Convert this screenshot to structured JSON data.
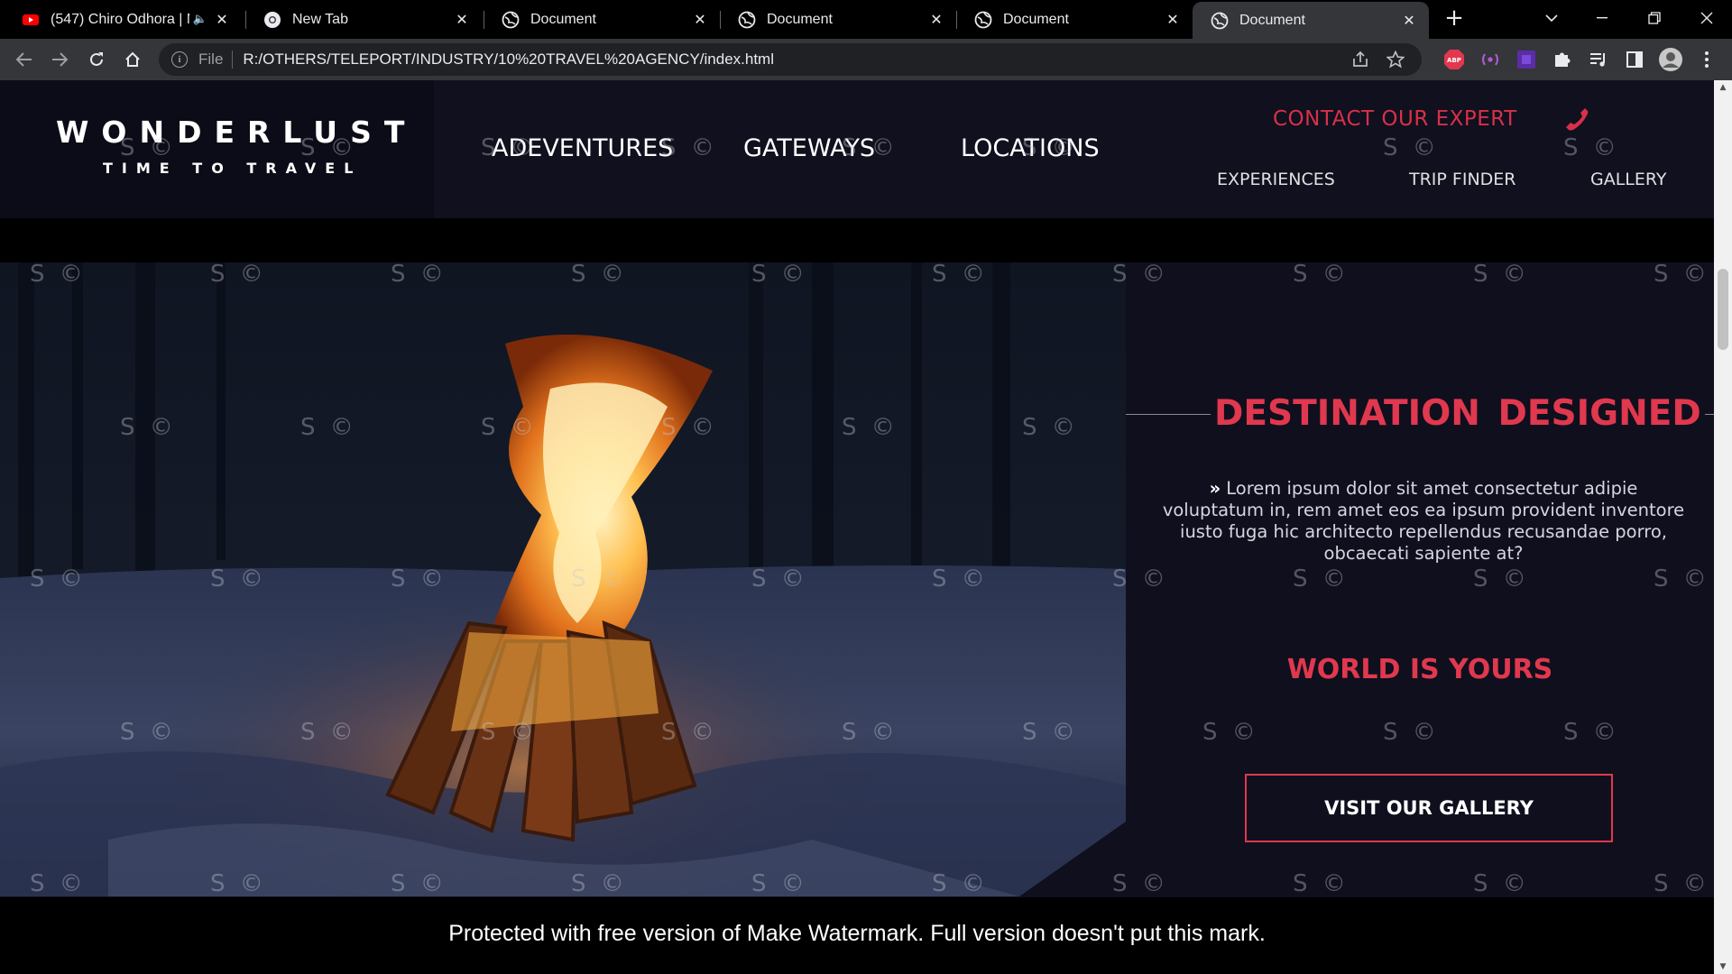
{
  "browser": {
    "tabs": [
      {
        "title": "(547) Chiro Odhora | M",
        "favicon": "youtube-icon",
        "muted": true,
        "active": false
      },
      {
        "title": "New Tab",
        "favicon": "chrome-icon",
        "active": false
      },
      {
        "title": "Document",
        "favicon": "globe-icon",
        "active": false
      },
      {
        "title": "Document",
        "favicon": "globe-icon",
        "active": false
      },
      {
        "title": "Document",
        "favicon": "globe-icon",
        "active": false
      },
      {
        "title": "Document",
        "favicon": "globe-icon",
        "active": true
      }
    ],
    "address": {
      "scheme_label": "File",
      "url": "R:/OTHERS/TELEPORT/INDUSTRY/10%20TRAVEL%20AGENCY/index.html"
    },
    "extensions": [
      "abp-icon",
      "radio-icon",
      "purple-ext-icon",
      "puzzle-icon",
      "media-icon",
      "sidepanel-icon",
      "profile-avatar"
    ]
  },
  "site": {
    "logo": {
      "brand": "WONDERLUST",
      "tagline": "TIME TO TRAVEL"
    },
    "main_nav": [
      "ADEVENTURES",
      "GATEWAYS",
      "LOCATIONS"
    ],
    "sub_nav": [
      "EXPERIENCES",
      "TRIP FINDER",
      "GALLERY"
    ],
    "contact": "CONTACT OUR EXPERT",
    "hero": {
      "title": "DESTINATION  DESIGNED",
      "text": "Lorem ipsum dolor sit amet consectetur adipie voluptatum in, rem amet eos ea ipsum provident inventore iusto fuga hic architecto repellendus recusandae porro, obcaecati sapiente at?",
      "subtitle": "WORLD IS YOURS",
      "button": "VISIT OUR GALLERY"
    }
  },
  "watermark": {
    "mark": "S ©",
    "notice": "Protected with free version of Make Watermark. Full version doesn't put this mark."
  },
  "colors": {
    "accent": "#e0384e",
    "page_bg": "#0f0f1e",
    "chrome_bg": "#35363a"
  }
}
